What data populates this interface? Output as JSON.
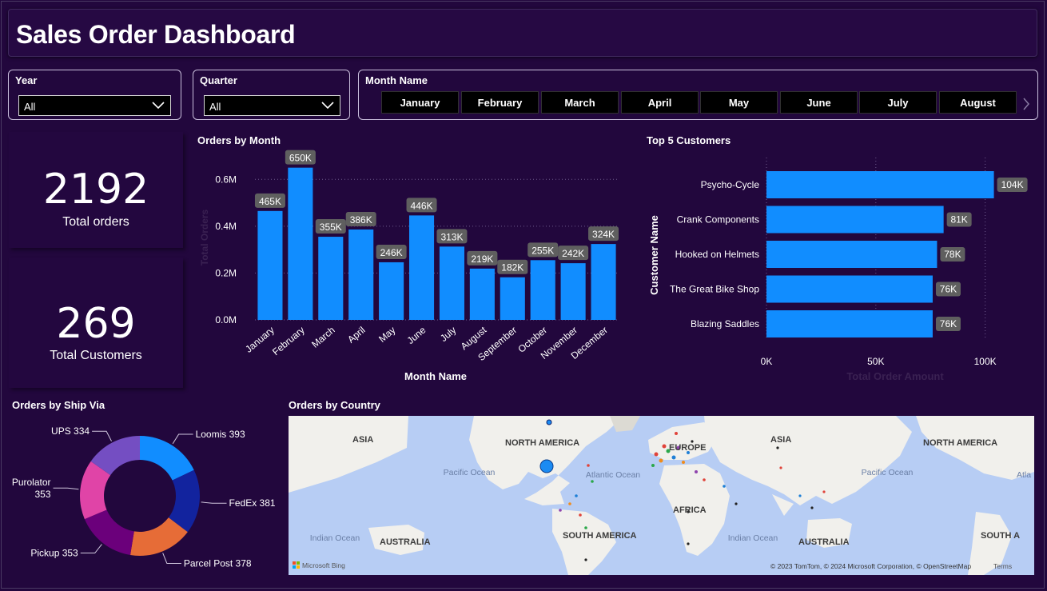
{
  "header": {
    "title": "Sales Order Dashboard"
  },
  "slicers": {
    "year": {
      "label": "Year",
      "value": "All"
    },
    "quarter": {
      "label": "Quarter",
      "value": "All"
    },
    "month": {
      "label": "Month Name",
      "buttons": [
        "January",
        "February",
        "March",
        "April",
        "May",
        "June",
        "July",
        "August"
      ]
    }
  },
  "kpis": {
    "orders": {
      "value": "2192",
      "caption": "Total orders"
    },
    "customers": {
      "value": "269",
      "caption": "Total Customers"
    }
  },
  "chart_data": [
    {
      "type": "bar",
      "title": "Orders by Month",
      "xlabel": "Month Name",
      "ylabel": "Total Orders",
      "categories": [
        "January",
        "February",
        "March",
        "April",
        "May",
        "June",
        "July",
        "August",
        "September",
        "October",
        "November",
        "December"
      ],
      "values": [
        465000,
        650000,
        355000,
        386000,
        246000,
        446000,
        313000,
        219000,
        182000,
        255000,
        242000,
        324000
      ],
      "data_labels": [
        "465K",
        "650K",
        "355K",
        "386K",
        "246K",
        "446K",
        "313K",
        "219K",
        "182K",
        "255K",
        "242K",
        "324K"
      ],
      "yticks": [
        "0.0M",
        "0.2M",
        "0.4M",
        "0.6M"
      ],
      "ylim": [
        0,
        700000
      ],
      "color": "#118dff"
    },
    {
      "type": "bar",
      "orientation": "horizontal",
      "title": "Top 5 Customers",
      "xlabel": "Total Order Amount",
      "ylabel": "Customer Name",
      "categories": [
        "Psycho-Cycle",
        "Crank Components",
        "Hooked on Helmets",
        "The Great Bike Shop",
        "Blazing Saddles"
      ],
      "values": [
        104000,
        81000,
        78000,
        76000,
        76000
      ],
      "data_labels": [
        "104K",
        "81K",
        "78K",
        "76K",
        "76K"
      ],
      "xticks": [
        "0K",
        "50K",
        "100K"
      ],
      "xlim": [
        0,
        110000
      ],
      "color": "#118dff"
    },
    {
      "type": "pie",
      "donut": true,
      "title": "Orders by Ship Via",
      "categories": [
        "Loomis",
        "FedEx",
        "Parcel Post",
        "Pickup",
        "Purolator",
        "UPS"
      ],
      "values": [
        393,
        381,
        378,
        353,
        353,
        334
      ],
      "labels": [
        "Loomis 393",
        "FedEx 381",
        "Parcel Post 378",
        "Pickup 353",
        "Purolator 353",
        "UPS 334"
      ],
      "colors": [
        "#118dff",
        "#12239e",
        "#e66c37",
        "#6b007b",
        "#e044a7",
        "#744ec2"
      ]
    }
  ],
  "map": {
    "title": "Orders by Country",
    "labels": {
      "asia_l": "ASIA",
      "north_america": "NORTH AMERICA",
      "europe": "EUROPE",
      "asia_r": "ASIA",
      "north_america_r": "NORTH AMERICA",
      "pacific": "Pacific Ocean",
      "atlantic": "Atlantic Ocean",
      "pacific_r": "Pacific Ocean",
      "atlantic_r": "Atla",
      "africa": "AFRICA",
      "indian_l": "Indian Ocean",
      "indian_r": "Indian Ocean",
      "australia_l": "AUSTRALIA",
      "south_america": "SOUTH AMERICA",
      "australia_r": "AUSTRALIA",
      "south_a_r": "SOUTH A"
    },
    "bing": "Microsoft Bing",
    "copyright": "© 2023 TomTom, © 2024 Microsoft Corporation, © OpenStreetMap",
    "terms": "Terms"
  }
}
